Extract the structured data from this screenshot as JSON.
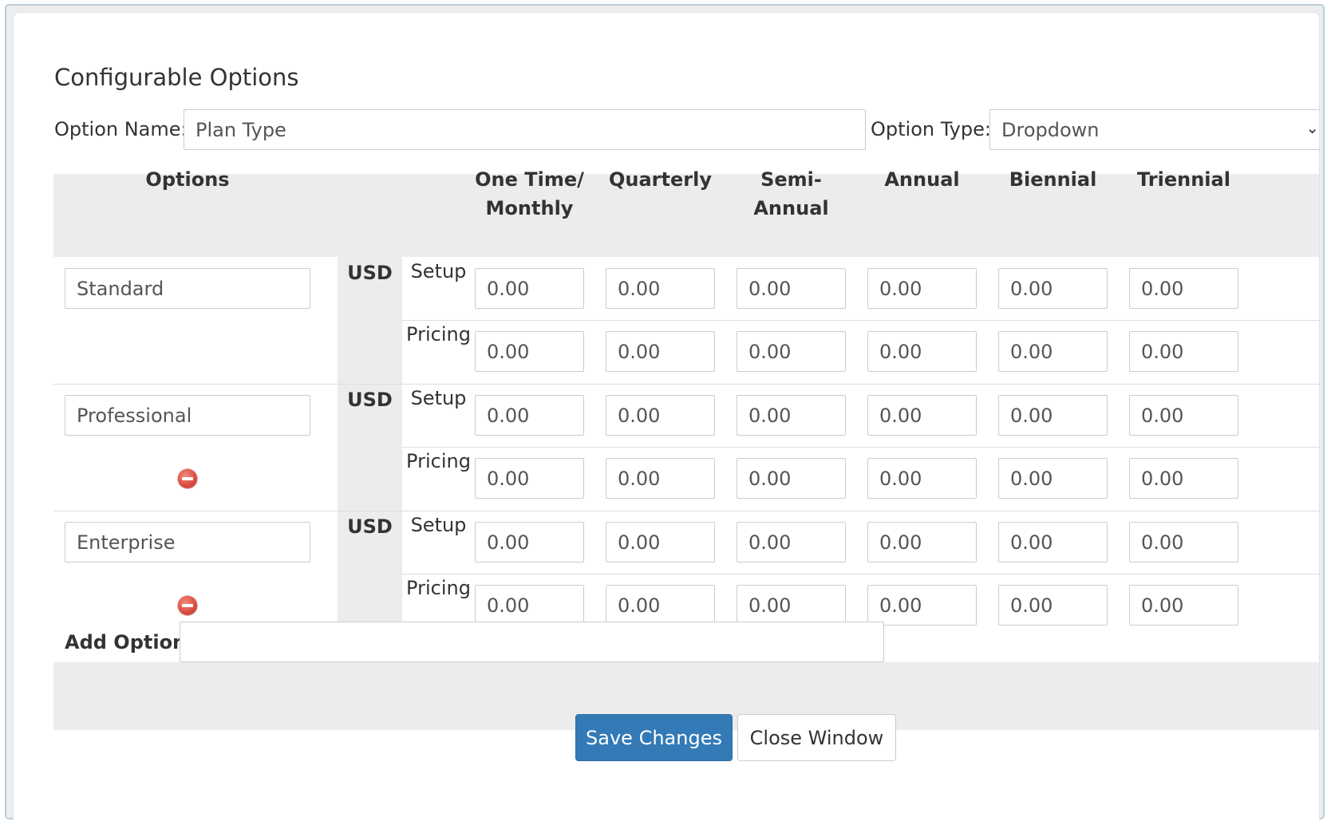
{
  "page": {
    "title": "Configurable Options",
    "option_name_label": "Option Name:",
    "option_name_value": "Plan Type",
    "option_type_label": "Option Type:",
    "option_type_value": "Dropdown"
  },
  "table": {
    "headers": {
      "options": "Options",
      "cycles": [
        [
          "One Time/",
          "Monthly"
        ],
        [
          "Quarterly"
        ],
        [
          "Semi-",
          "Annual"
        ],
        [
          "Annual"
        ],
        [
          "Biennial"
        ],
        [
          "Triennial"
        ]
      ]
    },
    "currency": "USD",
    "setup_label": "Setup",
    "pricing_label": "Pricing",
    "rows": [
      {
        "name": "Standard",
        "removable": false,
        "setup": [
          "0.00",
          "0.00",
          "0.00",
          "0.00",
          "0.00",
          "0.00"
        ],
        "pricing": [
          "0.00",
          "0.00",
          "0.00",
          "0.00",
          "0.00",
          "0.00"
        ]
      },
      {
        "name": "Professional",
        "removable": true,
        "setup": [
          "0.00",
          "0.00",
          "0.00",
          "0.00",
          "0.00",
          "0.00"
        ],
        "pricing": [
          "0.00",
          "0.00",
          "0.00",
          "0.00",
          "0.00",
          "0.00"
        ]
      },
      {
        "name": "Enterprise",
        "removable": true,
        "setup": [
          "0.00",
          "0.00",
          "0.00",
          "0.00",
          "0.00",
          "0.00"
        ],
        "pricing": [
          "0.00",
          "0.00",
          "0.00",
          "0.00",
          "0.00",
          "0.00"
        ]
      }
    ]
  },
  "add_option": {
    "label": "Add Option:",
    "value": ""
  },
  "buttons": {
    "save": "Save Changes",
    "close": "Close Window"
  },
  "icons": {
    "remove": "remove-icon",
    "dropdown": "chevron-down-icon"
  },
  "colors": {
    "primary": "#337ab7",
    "remove": "#d94a3e",
    "band": "#ececec"
  }
}
